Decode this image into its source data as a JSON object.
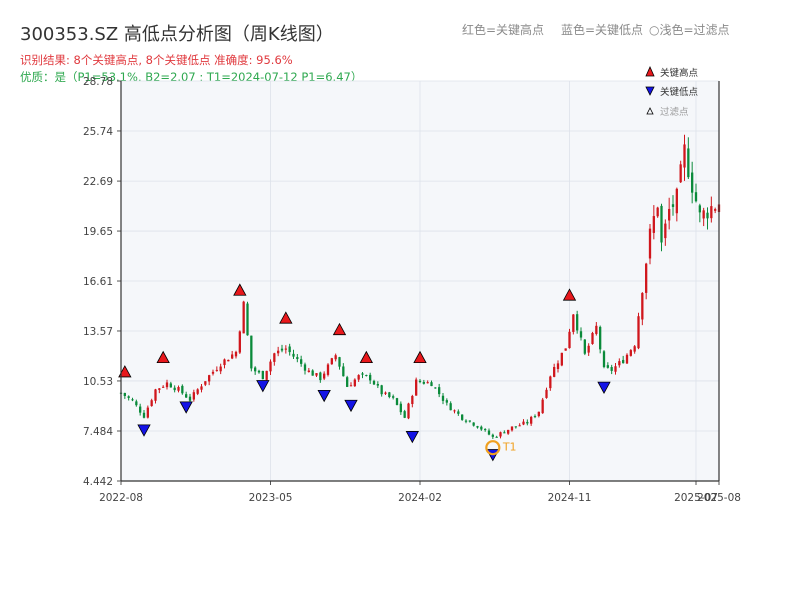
{
  "title": "300353.SZ 高低点分析图（周K线图）",
  "hints": {
    "red": "红色=关键高点",
    "blue": "蓝色=关键低点",
    "hollow": "○浅色=过滤点"
  },
  "subtitle": {
    "line1": "识别结果: 8个关键高点, 8个关键低点  准确度: 95.6%",
    "line2": "优质：是（P1=53.1%, B2=2.07 ; T1=2024-07-12 P1=6.47）"
  },
  "colors": {
    "up": "#d0161c",
    "down": "#0a8a3a",
    "high_marker": "#e8181c",
    "low_marker": "#1414e6",
    "t1": "#f0a020",
    "plot_bg": "#f5f7fa",
    "grid": "#dde2ea"
  },
  "chart_data": {
    "type": "candlestick",
    "period": "weekly",
    "y_ticks": [
      "4.442",
      "7.484",
      "10.53",
      "13.57",
      "16.61",
      "19.65",
      "22.69",
      "25.74",
      "28.78"
    ],
    "ylim": [
      4.442,
      28.78
    ],
    "x_ticks": [
      {
        "label": "2022-08",
        "week": 0
      },
      {
        "label": "2023-05",
        "week": 39
      },
      {
        "label": "2024-02",
        "week": 78
      },
      {
        "label": "2024-11",
        "week": 117
      },
      {
        "label": "2025-07",
        "week": 150
      },
      {
        "label": "2025-08",
        "week": 156
      }
    ],
    "week_range": [
      0,
      156
    ],
    "close_path": [
      [
        0,
        9.8
      ],
      [
        3,
        9.3
      ],
      [
        6,
        8.4
      ],
      [
        9,
        10.0
      ],
      [
        12,
        10.4
      ],
      [
        15,
        10.0
      ],
      [
        18,
        9.4
      ],
      [
        22,
        10.6
      ],
      [
        26,
        11.6
      ],
      [
        30,
        12.3
      ],
      [
        32,
        15.2
      ],
      [
        34,
        11.3
      ],
      [
        37,
        10.8
      ],
      [
        40,
        12.2
      ],
      [
        43,
        12.5
      ],
      [
        46,
        11.8
      ],
      [
        49,
        11.1
      ],
      [
        52,
        10.7
      ],
      [
        56,
        12.1
      ],
      [
        59,
        10.2
      ],
      [
        62,
        10.8
      ],
      [
        65,
        10.7
      ],
      [
        68,
        9.8
      ],
      [
        71,
        9.4
      ],
      [
        74,
        8.3
      ],
      [
        77,
        10.5
      ],
      [
        81,
        10.4
      ],
      [
        85,
        9.1
      ],
      [
        89,
        8.3
      ],
      [
        93,
        7.8
      ],
      [
        97,
        7.1
      ],
      [
        102,
        7.7
      ],
      [
        106,
        8.0
      ],
      [
        109,
        8.7
      ],
      [
        112,
        10.9
      ],
      [
        116,
        12.6
      ],
      [
        118,
        14.7
      ],
      [
        121,
        12.1
      ],
      [
        124,
        13.8
      ],
      [
        126,
        11.2
      ],
      [
        128,
        11.2
      ],
      [
        131,
        11.8
      ],
      [
        134,
        12.8
      ],
      [
        136,
        16.3
      ],
      [
        138,
        19.4
      ],
      [
        140,
        21.4
      ],
      [
        141,
        18.8
      ],
      [
        143,
        20.9
      ],
      [
        145,
        21.6
      ],
      [
        147,
        24.5
      ],
      [
        149,
        22.5
      ],
      [
        151,
        20.5
      ],
      [
        154,
        21.1
      ],
      [
        156,
        21.4
      ]
    ],
    "key_highs": [
      {
        "week": 1,
        "price": 10.53
      },
      {
        "week": 11,
        "price": 11.4
      },
      {
        "week": 31,
        "price": 15.5
      },
      {
        "week": 43,
        "price": 13.8
      },
      {
        "week": 57,
        "price": 13.1
      },
      {
        "week": 64,
        "price": 11.4
      },
      {
        "week": 78,
        "price": 11.4
      },
      {
        "week": 117,
        "price": 15.2
      }
    ],
    "key_lows": [
      {
        "week": 6,
        "price": 8.1
      },
      {
        "week": 17,
        "price": 9.5
      },
      {
        "week": 37,
        "price": 10.8
      },
      {
        "week": 53,
        "price": 10.2
      },
      {
        "week": 60,
        "price": 9.6
      },
      {
        "week": 76,
        "price": 7.7
      },
      {
        "week": 97,
        "price": 6.6
      },
      {
        "week": 126,
        "price": 10.7
      }
    ],
    "t1": {
      "label": "T1",
      "week": 97,
      "price": 6.47
    },
    "legend": {
      "high": "关键高点",
      "low": "关键低点",
      "filtered": "过滤点"
    }
  }
}
